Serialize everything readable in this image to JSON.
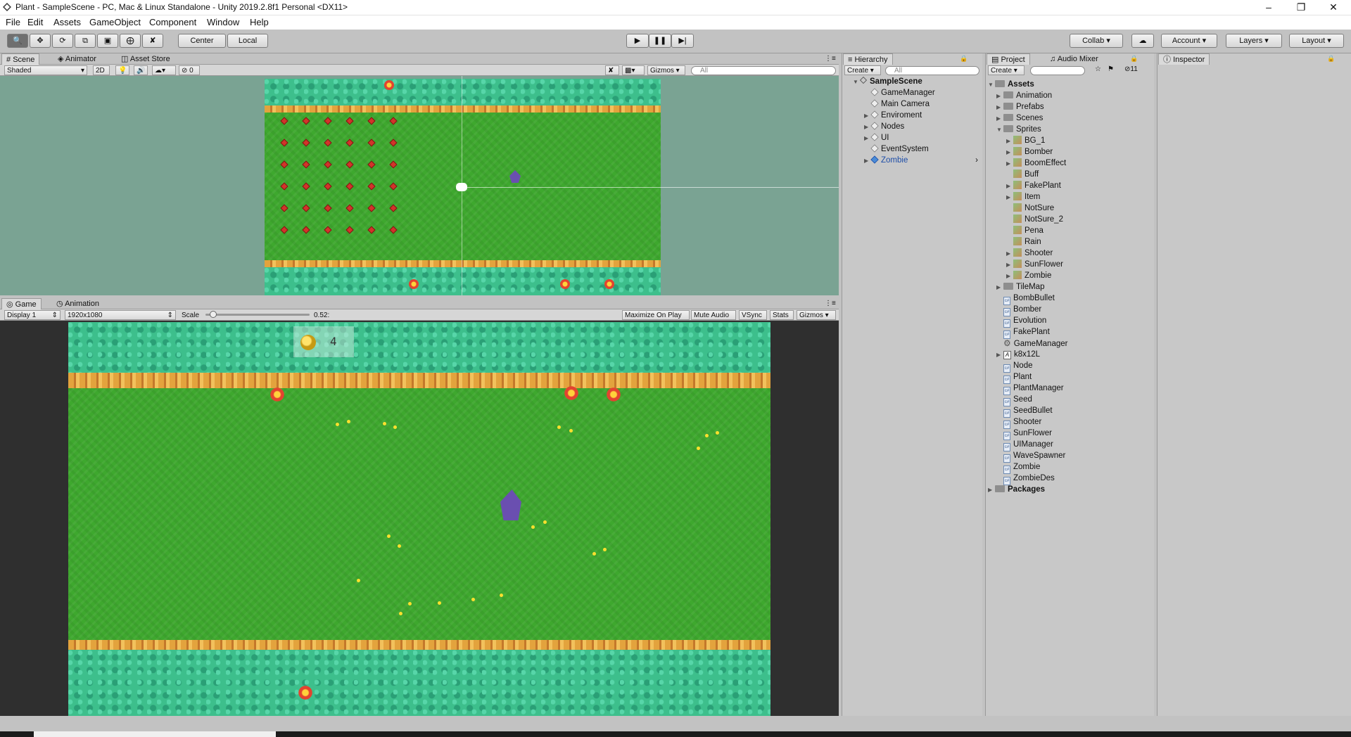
{
  "window": {
    "title": "Plant - SampleScene - PC, Mac & Linux Standalone - Unity 2019.2.8f1 Personal <DX11>"
  },
  "menu": [
    "File",
    "Edit",
    "Assets",
    "GameObject",
    "Component",
    "Window",
    "Help"
  ],
  "toolbar": {
    "pivot_center": "Center",
    "pivot_local": "Local",
    "collab": "Collab",
    "account": "Account",
    "layers": "Layers",
    "layout": "Layout"
  },
  "scene": {
    "tabs": [
      "Scene",
      "Animator",
      "Asset Store"
    ],
    "shading": "Shaded",
    "mode_2d": "2D",
    "hidden_count": "0",
    "gizmos": "Gizmos",
    "search_placeholder": "All"
  },
  "game": {
    "tabs": [
      "Game",
      "Animation"
    ],
    "display": "Display 1",
    "resolution": "1920x1080",
    "scale_label": "Scale",
    "scale_value": "0.52",
    "scale_readout": "0.52:",
    "buttons": [
      "Maximize On Play",
      "Mute Audio",
      "VSync",
      "Stats",
      "Gizmos"
    ],
    "seed_count": "4"
  },
  "hierarchy": {
    "tab": "Hierarchy",
    "create": "Create",
    "search_placeholder": "All",
    "scene": "SampleScene",
    "items": [
      {
        "label": "GameManager",
        "expandable": false,
        "selected": false
      },
      {
        "label": "Main Camera",
        "expandable": false,
        "selected": false
      },
      {
        "label": "Enviroment",
        "expandable": true,
        "selected": false
      },
      {
        "label": "Nodes",
        "expandable": true,
        "selected": false
      },
      {
        "label": "UI",
        "expandable": true,
        "selected": false
      },
      {
        "label": "EventSystem",
        "expandable": false,
        "selected": false
      },
      {
        "label": "Zombie",
        "expandable": true,
        "selected": true
      }
    ]
  },
  "project": {
    "tabs": [
      "Project",
      "Audio Mixer"
    ],
    "create": "Create",
    "hidden_count": "11",
    "root": "Assets",
    "folders": [
      "Animation",
      "Prefabs",
      "Scenes",
      "Sprites"
    ],
    "sprites": [
      {
        "label": "BG_1",
        "expandable": true
      },
      {
        "label": "Bomber",
        "expandable": true
      },
      {
        "label": "BoomEffect",
        "expandable": true
      },
      {
        "label": "Buff",
        "expandable": false
      },
      {
        "label": "FakePlant",
        "expandable": true
      },
      {
        "label": "Item",
        "expandable": true
      },
      {
        "label": "NotSure",
        "expandable": false
      },
      {
        "label": "NotSure_2",
        "expandable": false
      },
      {
        "label": "Pena",
        "expandable": false
      },
      {
        "label": "Rain",
        "expandable": false
      },
      {
        "label": "Shooter",
        "expandable": true
      },
      {
        "label": "SunFlower",
        "expandable": true
      },
      {
        "label": "Zombie",
        "expandable": true
      }
    ],
    "tilemap": "TileMap",
    "files": [
      {
        "label": "BombBullet",
        "kind": "script"
      },
      {
        "label": "Bomber",
        "kind": "script"
      },
      {
        "label": "Evolution",
        "kind": "script"
      },
      {
        "label": "FakePlant",
        "kind": "script"
      },
      {
        "label": "GameManager",
        "kind": "gear"
      },
      {
        "label": "k8x12L",
        "kind": "font"
      },
      {
        "label": "Node",
        "kind": "script"
      },
      {
        "label": "Plant",
        "kind": "script"
      },
      {
        "label": "PlantManager",
        "kind": "script"
      },
      {
        "label": "Seed",
        "kind": "script"
      },
      {
        "label": "SeedBullet",
        "kind": "script"
      },
      {
        "label": "Shooter",
        "kind": "script"
      },
      {
        "label": "SunFlower",
        "kind": "script"
      },
      {
        "label": "UIManager",
        "kind": "script"
      },
      {
        "label": "WaveSpawner",
        "kind": "script"
      },
      {
        "label": "Zombie",
        "kind": "script"
      },
      {
        "label": "ZombieDes",
        "kind": "script"
      }
    ],
    "packages": "Packages"
  },
  "inspector": {
    "tab": "Inspector"
  },
  "colors": {
    "selected_text": "#1e4ea8",
    "scene_bg": "#7aa393",
    "grass": "#3ea82e",
    "editor_gray": "#c2c2c2"
  }
}
